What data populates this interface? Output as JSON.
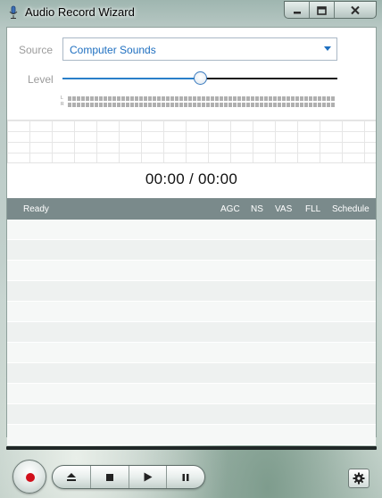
{
  "window": {
    "title": "Audio Record Wizard",
    "icons": {
      "app": "microphone-icon",
      "minimize": "minimize-icon",
      "maximize": "maximize-icon",
      "close": "close-icon"
    }
  },
  "source": {
    "label": "Source",
    "selected": "Computer Sounds"
  },
  "level": {
    "label": "Level",
    "value_fraction": 0.5,
    "meter_channels": [
      "L",
      "R"
    ]
  },
  "timer": {
    "display": "00:00 / 00:00"
  },
  "list": {
    "status": "Ready",
    "columns": [
      "AGC",
      "NS",
      "VAS",
      "FLL",
      "Schedule"
    ]
  },
  "controls": {
    "record": "record-icon",
    "eject": "eject-icon",
    "stop": "stop-icon",
    "play": "play-icon",
    "pause": "pause-icon",
    "settings": "gear-icon"
  },
  "colors": {
    "accent": "#1e6fc0",
    "record": "#d10f1b",
    "header": "#7a8a8b"
  }
}
